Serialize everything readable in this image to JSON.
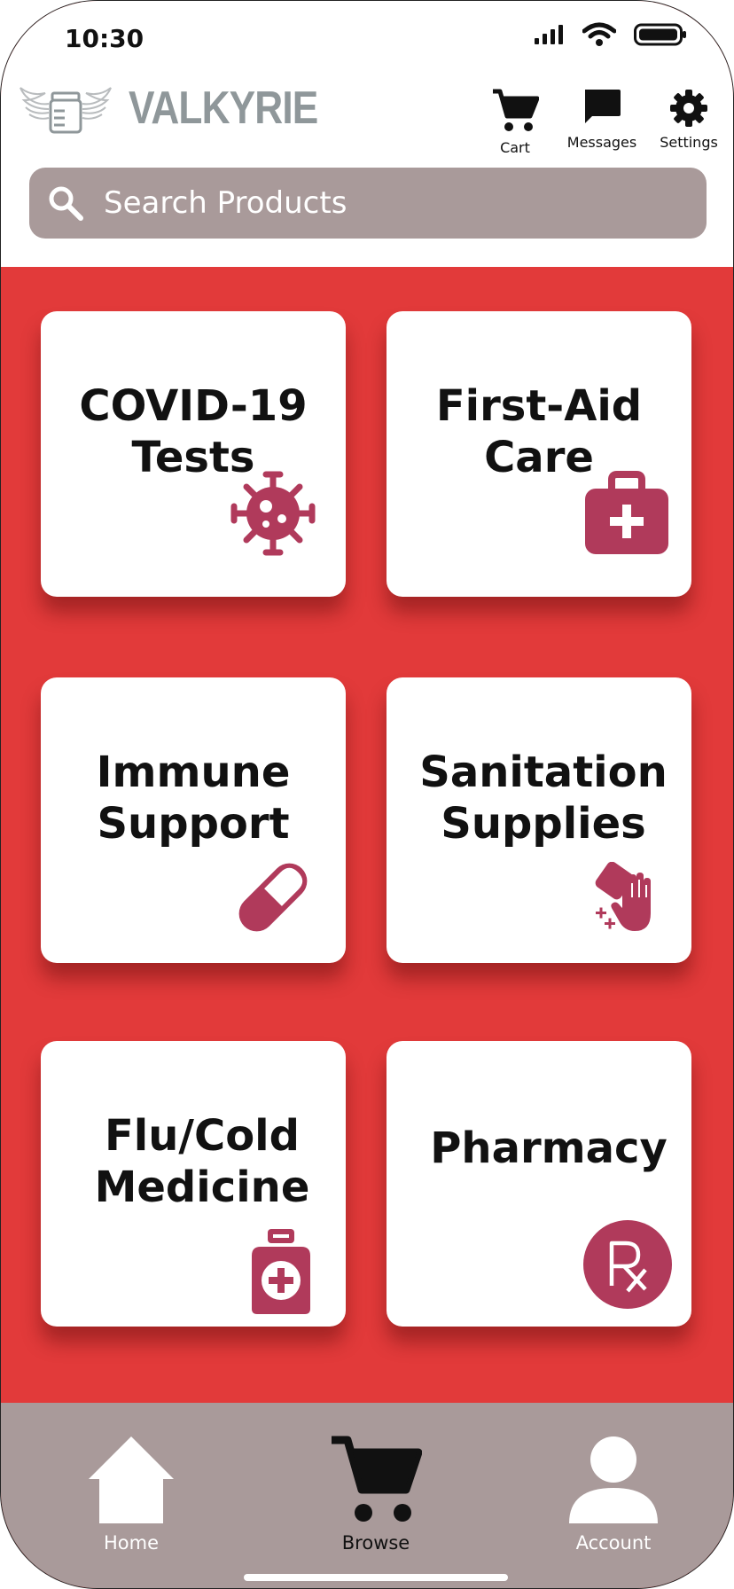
{
  "status": {
    "time": "10:30"
  },
  "brand": {
    "name": "VALKYRIE"
  },
  "header": {
    "cart_label": "Cart",
    "messages_label": "Messages",
    "settings_label": "Settings"
  },
  "search": {
    "placeholder": "Search Products"
  },
  "categories": [
    {
      "line1": "COVID-19",
      "line2": "Tests",
      "icon": "virus-icon"
    },
    {
      "line1": "First-Aid",
      "line2": "Care",
      "icon": "first-aid-kit-icon"
    },
    {
      "line1": "Immune",
      "line2": "Support",
      "icon": "pill-capsule-icon"
    },
    {
      "line1": "Sanitation",
      "line2": "Supplies",
      "icon": "hand-sanitizer-icon"
    },
    {
      "line1": "Flu/Cold",
      "line2": "Medicine",
      "icon": "medicine-bottle-icon"
    },
    {
      "line1": "Pharmacy",
      "line2": "",
      "icon": "rx-icon"
    }
  ],
  "bottom_nav": {
    "home_label": "Home",
    "browse_label": "Browse",
    "account_label": "Account",
    "active": "Browse"
  },
  "colors": {
    "background": "#e23a3a",
    "icon": "#b03a5b",
    "nav": "#a99a9a",
    "brand": "#8f979a"
  }
}
